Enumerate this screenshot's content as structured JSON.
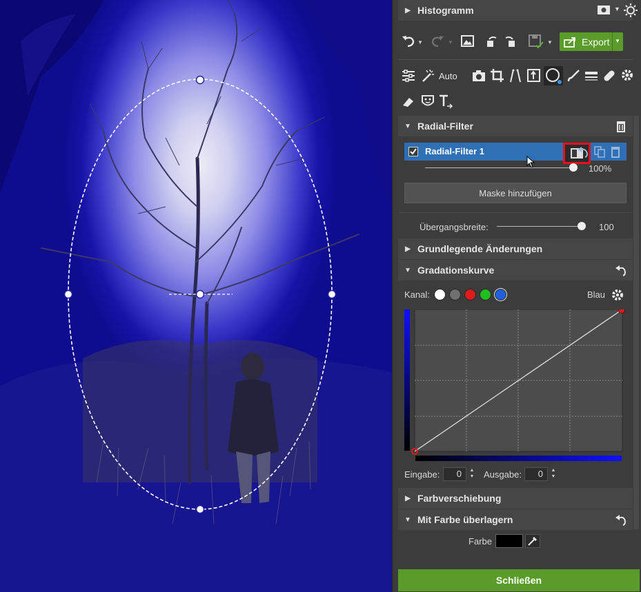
{
  "top_bar": {
    "section_title": "Histogramm"
  },
  "toolbar": {
    "export_label": "Export",
    "auto_label": "Auto"
  },
  "radial_filter": {
    "section_title": "Radial-Filter",
    "filter_name": "Radial-Filter 1",
    "opacity_value": "100%",
    "add_mask_label": "Maske hinzufügen",
    "transition_label": "Übergangsbreite:",
    "transition_value": "100"
  },
  "sections": {
    "basic": "Grundlegende Änderungen",
    "curve": "Gradationskurve",
    "colorshift": "Farbverschiebung",
    "overlay": "Mit Farbe überlagern"
  },
  "curve": {
    "channel_label": "Kanal:",
    "channel_value": "Blau",
    "channel_colors": [
      "#ffffff",
      "#707070",
      "#e01b1b",
      "#1fbf1f",
      "#2160d8"
    ],
    "input_label": "Eingabe:",
    "input_value": "0",
    "output_label": "Ausgabe:",
    "output_value": "0"
  },
  "overlay": {
    "color_label": "Farbe",
    "color_value": "#000000"
  },
  "footer": {
    "close_label": "Schließen"
  },
  "colors": {
    "accent_green": "#5a9c2a",
    "selection_blue": "#2e6fb6",
    "highlight_red": "#e8101a",
    "mask_blue": "#1813a6"
  }
}
